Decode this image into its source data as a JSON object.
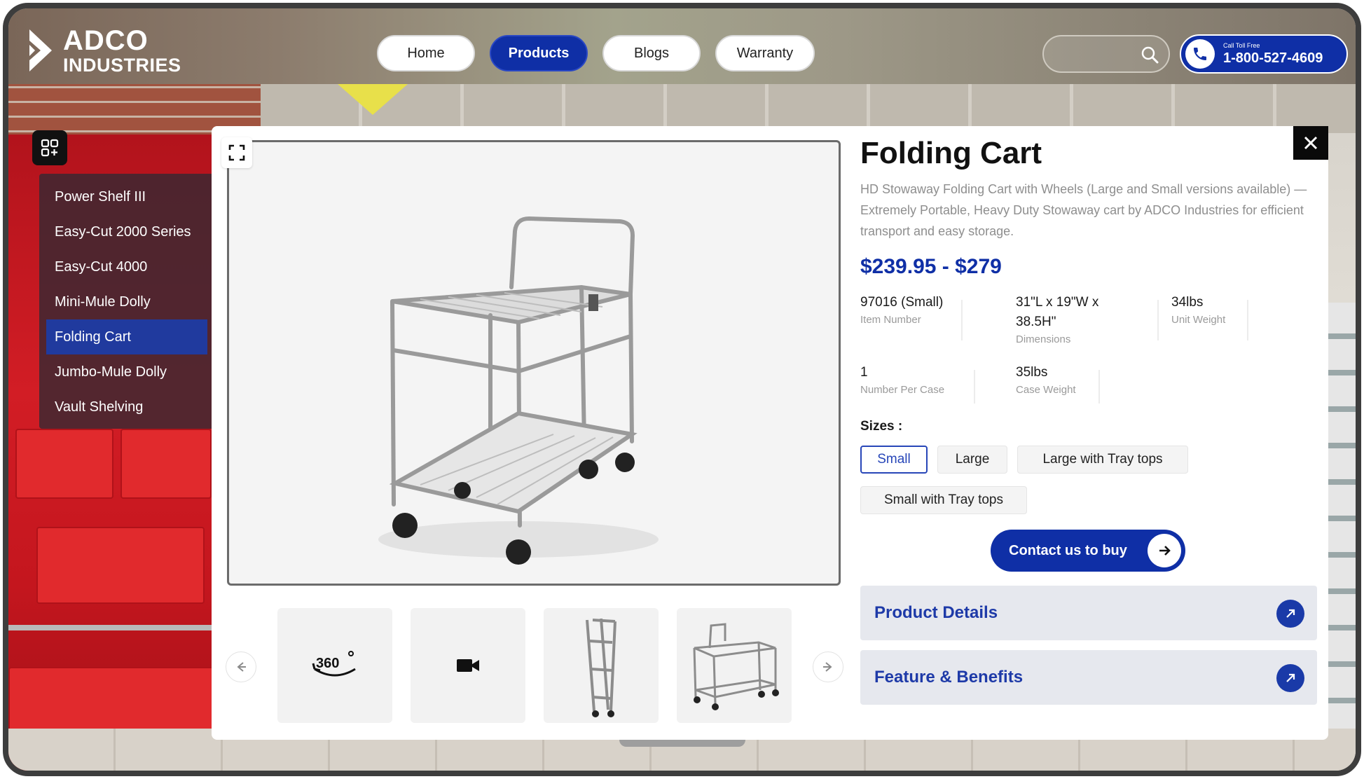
{
  "header": {
    "logo": {
      "line1": "ADCO",
      "line2": "INDUSTRIES"
    },
    "nav": [
      {
        "label": "Home",
        "active": false
      },
      {
        "label": "Products",
        "active": true
      },
      {
        "label": "Blogs",
        "active": false
      },
      {
        "label": "Warranty",
        "active": false
      }
    ],
    "search": {
      "placeholder": "",
      "icon": "search-icon"
    },
    "phone": {
      "caption": "Call Toll Free",
      "number": "1-800-527-4609",
      "icon": "phone-icon"
    }
  },
  "sidebar": {
    "toggle_icon": "grid-menu-icon",
    "items": [
      {
        "label": "Power Shelf III",
        "active": false
      },
      {
        "label": "Easy-Cut 2000 Series",
        "active": false
      },
      {
        "label": "Easy-Cut 4000",
        "active": false
      },
      {
        "label": "Mini-Mule Dolly",
        "active": false
      },
      {
        "label": "Folding Cart",
        "active": true
      },
      {
        "label": "Jumbo-Mule Dolly",
        "active": false
      },
      {
        "label": "Vault Shelving",
        "active": false
      }
    ]
  },
  "product": {
    "title": "Folding Cart",
    "description": "HD Stowaway Folding Cart with Wheels (Large and Small versions available) — Extremely Portable, Heavy Duty Stowaway cart by ADCO Industries for efficient transport and easy storage.",
    "price": "$239.95 - $279",
    "specs": {
      "item_number": {
        "value": "97016 (Small)",
        "label": "Item Number"
      },
      "dimensions": {
        "value_line1": "31\"L x 19\"W x",
        "value_line2": "38.5H\"",
        "label": "Dimensions"
      },
      "unit_weight": {
        "value": "34lbs",
        "label": "Unit Weight"
      },
      "number_per_case": {
        "value": "1",
        "label": "Number Per Case"
      },
      "case_weight": {
        "value": "35lbs",
        "label": "Case Weight"
      }
    },
    "sizes_label": "Sizes :",
    "sizes": [
      {
        "label": "Small",
        "active": true
      },
      {
        "label": "Large",
        "active": false
      },
      {
        "label": "Large with Tray tops",
        "active": false
      },
      {
        "label": "Small with Tray tops",
        "active": false
      }
    ],
    "contact_button": "Contact us to buy",
    "accordions": [
      {
        "label": "Product Details"
      },
      {
        "label": "Feature & Benefits"
      }
    ]
  },
  "media": {
    "thumbnails": [
      {
        "type": "360-view",
        "label": "360"
      },
      {
        "type": "video"
      },
      {
        "type": "image-folded"
      },
      {
        "type": "image-open"
      }
    ]
  },
  "colors": {
    "brand_blue": "#0f2fa6",
    "accent_blue": "#1e3aa8",
    "close_bg": "#0a0a0a"
  }
}
